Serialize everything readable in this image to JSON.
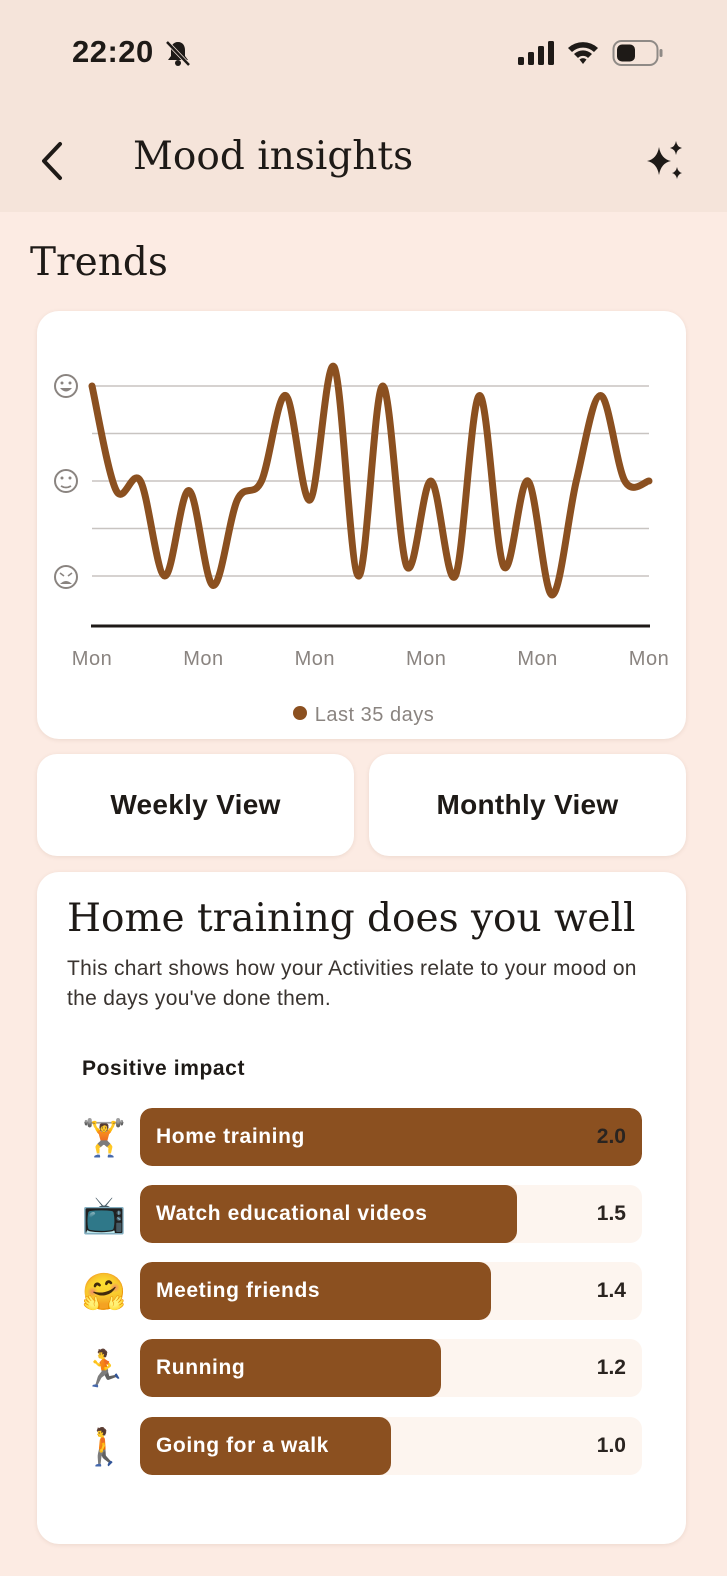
{
  "status_bar": {
    "time": "22:20"
  },
  "header": {
    "title": "Mood insights",
    "back_icon": "chevron-left-icon",
    "action_icon": "sparkle-icon"
  },
  "trends": {
    "title": "Trends",
    "legend": "Last 35 days",
    "accent_color": "#8b5020"
  },
  "chart_data": {
    "type": "line",
    "y_levels": [
      "happy",
      "neutral",
      "sad"
    ],
    "x_tick_labels": [
      "Mon",
      "Mon",
      "Mon",
      "Mon",
      "Mon",
      "Mon"
    ],
    "series": [
      {
        "name": "Last 35 days",
        "values": [
          4.0,
          2.9,
          3.0,
          2.0,
          2.9,
          1.9,
          2.8,
          3.0,
          3.9,
          2.8,
          4.2,
          2.0,
          4.0,
          2.1,
          3.0,
          2.0,
          3.9,
          2.1,
          3.0,
          1.8,
          3.0,
          3.9,
          3.0,
          3.0
        ]
      }
    ]
  },
  "views": {
    "weekly": "Weekly View",
    "monthly": "Monthly View"
  },
  "impact": {
    "title": "Home training does you well",
    "description": "This chart shows how your Activities relate to your mood on the days you've done them.",
    "subtitle": "Positive impact",
    "bar_color": "#8b5020",
    "max_value": 2.0,
    "activities": [
      {
        "emoji": "🏋️",
        "icon": "weightlifting-icon",
        "label": "Home training",
        "value": "2.0",
        "score": 2.0
      },
      {
        "emoji": "📺",
        "icon": "television-icon",
        "label": "Watch educational videos",
        "value": "1.5",
        "score": 1.5
      },
      {
        "emoji": "🤗",
        "icon": "hugging-face-icon",
        "label": "Meeting friends",
        "value": "1.4",
        "score": 1.4
      },
      {
        "emoji": "🏃",
        "icon": "running-icon",
        "label": "Running",
        "value": "1.2",
        "score": 1.2
      },
      {
        "emoji": "🚶",
        "icon": "walking-icon",
        "label": "Going for a walk",
        "value": "1.0",
        "score": 1.0
      }
    ]
  }
}
